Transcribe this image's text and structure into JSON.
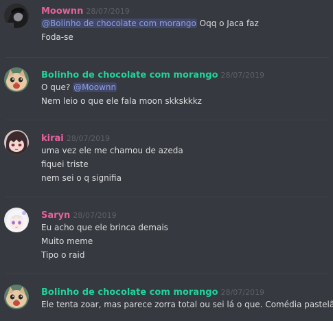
{
  "colors": {
    "background": "#36393f",
    "text": "#dcddde",
    "timestamp": "#5e6066",
    "mention_bg": "#414768",
    "mention_text": "#8ea1e1"
  },
  "messages": [
    {
      "author": "Moownn",
      "author_color": "#e4629d",
      "timestamp": "28/07/2019",
      "avatar_icon": "dark-character-avatar",
      "lines": [
        {
          "mention": "@Bolinho de chocolate com morango",
          "text": " Oqq o Jaca faz"
        },
        {
          "text": "Foda-se"
        }
      ]
    },
    {
      "author": "Bolinho de chocolate com morango",
      "author_color": "#1fd49a",
      "timestamp": "28/07/2019",
      "avatar_icon": "cat-avatar",
      "lines": [
        {
          "text": "O que? ",
          "mention": "@Moownn"
        },
        {
          "text": "Nem leio o que ele fala moon skkskkkz"
        }
      ]
    },
    {
      "author": "kirai",
      "author_color": "#e4629d",
      "timestamp": "28/07/2019",
      "avatar_icon": "anime-girl-avatar",
      "lines": [
        {
          "text": "uma vez ele me chamou de azeda"
        },
        {
          "text": "fiquei triste"
        },
        {
          "text": "nem sei o q signifia"
        }
      ]
    },
    {
      "author": "Saryn",
      "author_color": "#e4629d",
      "timestamp": "28/07/2019",
      "avatar_icon": "white-hair-girl-avatar",
      "lines": [
        {
          "text": "Eu acho que ele brinca demais"
        },
        {
          "text": "Muito meme"
        },
        {
          "text": "Tipo o raid"
        }
      ]
    },
    {
      "author": "Bolinho de chocolate com morango",
      "author_color": "#1fd49a",
      "timestamp": "28/07/2019",
      "avatar_icon": "cat-avatar",
      "lines": [
        {
          "text": "Ele tenta zoar, mas parece zorra total ou sei lá o que. Comédia pastelão"
        }
      ]
    }
  ]
}
